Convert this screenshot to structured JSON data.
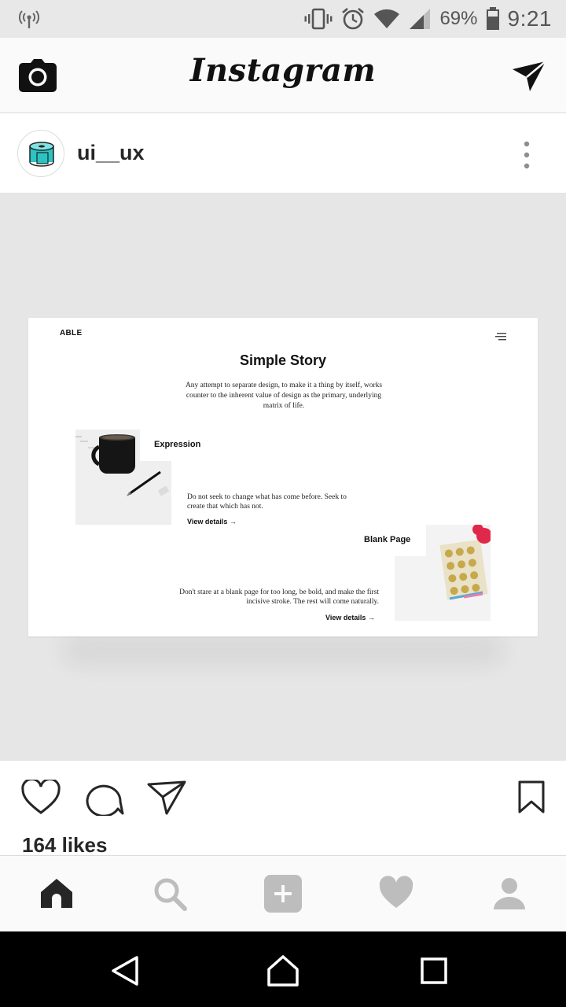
{
  "status_bar": {
    "battery_percent": "69%",
    "time": "9:21",
    "icons": [
      "hotspot-icon",
      "vibrate-icon",
      "alarm-icon",
      "wifi-icon",
      "cellular-signal-icon",
      "battery-icon"
    ]
  },
  "app_header": {
    "logo_text": "Instagram",
    "left_icon": "camera-icon",
    "right_icon": "direct-message-icon"
  },
  "post": {
    "username": "ui__ux",
    "avatar_icon": "toilet-paper-icon",
    "options_icon": "more-vertical-icon",
    "image": {
      "brand": "ABLE",
      "title": "Simple Story",
      "intro": "Any attempt to separate design, to make it a thing by itself, works counter to the inherent value of design as the primary, underlying matrix of life.",
      "section1": {
        "heading": "Expression",
        "text": "Do not seek to change what has come before. Seek to create that which has not.",
        "link": "View details →"
      },
      "section2": {
        "heading": "Blank Page",
        "text": "Don't stare at a blank page for too long, be bold, and make the first incisive stroke. The rest will come naturally.",
        "link": "View details →"
      }
    },
    "likes": "164 likes"
  },
  "actions": [
    "heart-icon",
    "comment-icon",
    "share-icon",
    "bookmark-icon"
  ],
  "bottom_nav": [
    "home-icon",
    "search-icon",
    "add-post-icon",
    "activity-icon",
    "profile-icon"
  ],
  "system_nav": [
    "back-icon",
    "home-button-icon",
    "recents-icon"
  ],
  "colors": {
    "status_bar_bg": "#e8e8e8",
    "app_bar_bg": "#fafafa",
    "media_bg": "#e6e6e6",
    "avatar_accent": "#2bc4c4",
    "system_nav_bg": "#000000"
  }
}
